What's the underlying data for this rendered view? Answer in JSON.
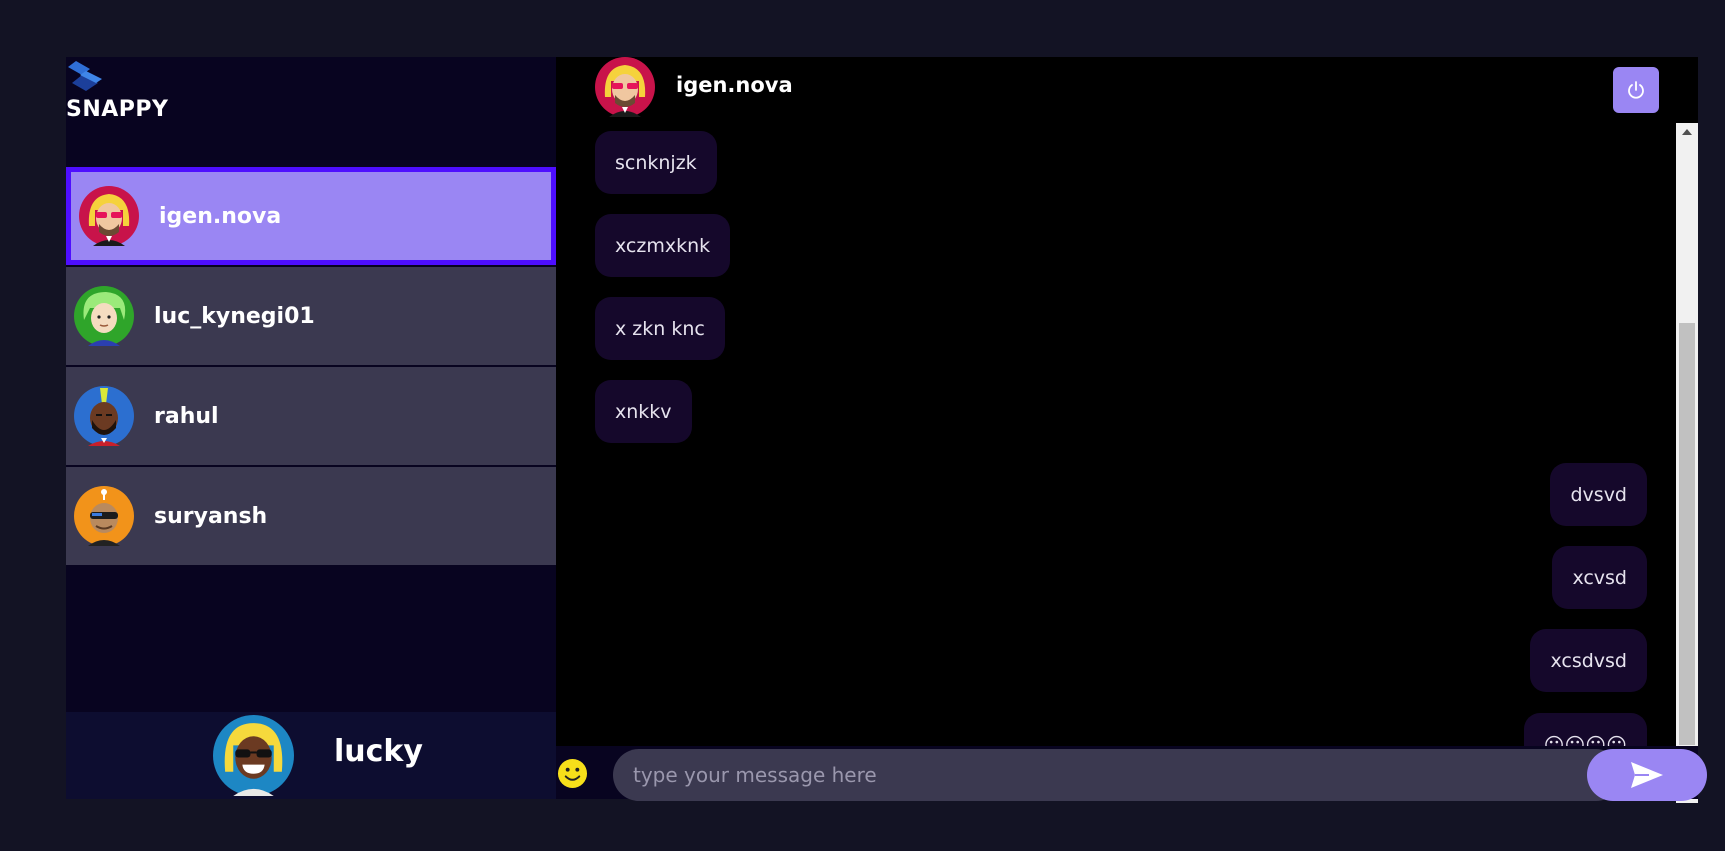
{
  "brand": {
    "name": "SNAPPY",
    "logo_icon": "snappy-logo-icon"
  },
  "contacts": [
    {
      "name": "igen.nova",
      "avatar": "blonde-sunglasses-avatar",
      "selected": true
    },
    {
      "name": "luc_kynegi01",
      "avatar": "green-hair-avatar",
      "selected": false
    },
    {
      "name": "rahul",
      "avatar": "mohawk-beard-avatar",
      "selected": false
    },
    {
      "name": "suryansh",
      "avatar": "robot-shades-avatar",
      "selected": false
    }
  ],
  "current_user": {
    "name": "lucky",
    "avatar": "blonde-grin-avatar"
  },
  "chat": {
    "contact_name": "igen.nova",
    "logout_icon": "power-icon",
    "messages": [
      {
        "text": "scnknjzk",
        "direction": "received"
      },
      {
        "text": "xczmxknk",
        "direction": "received"
      },
      {
        "text": "x zkn knc",
        "direction": "received"
      },
      {
        "text": "xnkkv",
        "direction": "received"
      },
      {
        "text": "dvsvd",
        "direction": "sent"
      },
      {
        "text": "xcvsd",
        "direction": "sent"
      },
      {
        "text": "xcsdvsd",
        "direction": "sent"
      },
      {
        "text": "😛😛😛😛",
        "direction": "sent"
      }
    ]
  },
  "input": {
    "placeholder": "type your message here",
    "value": "",
    "emoji_icon": "smiley-icon",
    "send_icon": "send-arrow-icon"
  },
  "colors": {
    "background": "#131324",
    "sidebar": "#080420",
    "contact": "#3b3950",
    "selected": "#9a86f3",
    "selected_border": "#4e0eff",
    "message_bubble": "#15082b",
    "accent": "#9a86f3"
  }
}
